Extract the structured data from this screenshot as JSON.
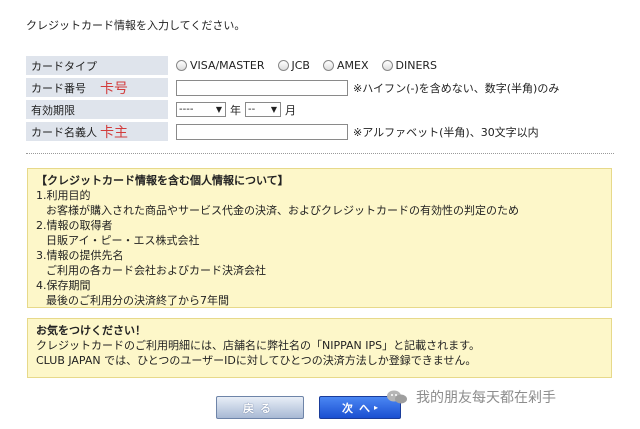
{
  "intro": "クレジットカード情報を入力してください。",
  "form": {
    "card_type": {
      "label": "カードタイプ",
      "options": [
        "VISA/MASTER",
        "JCB",
        "AMEX",
        "DINERS"
      ]
    },
    "card_number": {
      "label": "カード番号",
      "overlay": "卡号",
      "note": "※ハイフン(-)を含めない、数字(半角)のみ"
    },
    "expiry": {
      "label": "有効期限",
      "year_value": "----",
      "year_unit": "年",
      "month_value": "--",
      "month_unit": "月"
    },
    "holder": {
      "label": "カード名義人",
      "overlay": "卡主",
      "note": "※アルファベット(半角)、30文字以内"
    }
  },
  "privacy_box": {
    "title": "【クレジットカード情報を含む個人情報について】",
    "lines": [
      "1.利用目的",
      "お客様が購入された商品やサービス代金の決済、およびクレジットカードの有効性の判定のため",
      "2.情報の取得者",
      "日販アイ・ピー・エス株式会社",
      "3.情報の提供先名",
      "ご利用の各カード会社およびカード決済会社",
      "4.保存期間",
      "最後のご利用分の決済終了から7年間"
    ]
  },
  "notice_box": {
    "title": "お気をつけください！",
    "lines": [
      "クレジットカードのご利用明細には、店舗名に弊社名の「NIPPAN IPS」と記載されます。",
      "CLUB JAPAN では、ひとつのユーザーIDに対してひとつの決済方法しか登録できません。"
    ]
  },
  "buttons": {
    "back": "戻る",
    "next": "次へ"
  },
  "watermark": "我的朋友每天都在剁手",
  "colors": {
    "label_bg": "#dfe4ec",
    "box_bg": "#fdf7c9",
    "overlay_red": "#d23c3c",
    "next_btn": "#2a5fe0"
  }
}
